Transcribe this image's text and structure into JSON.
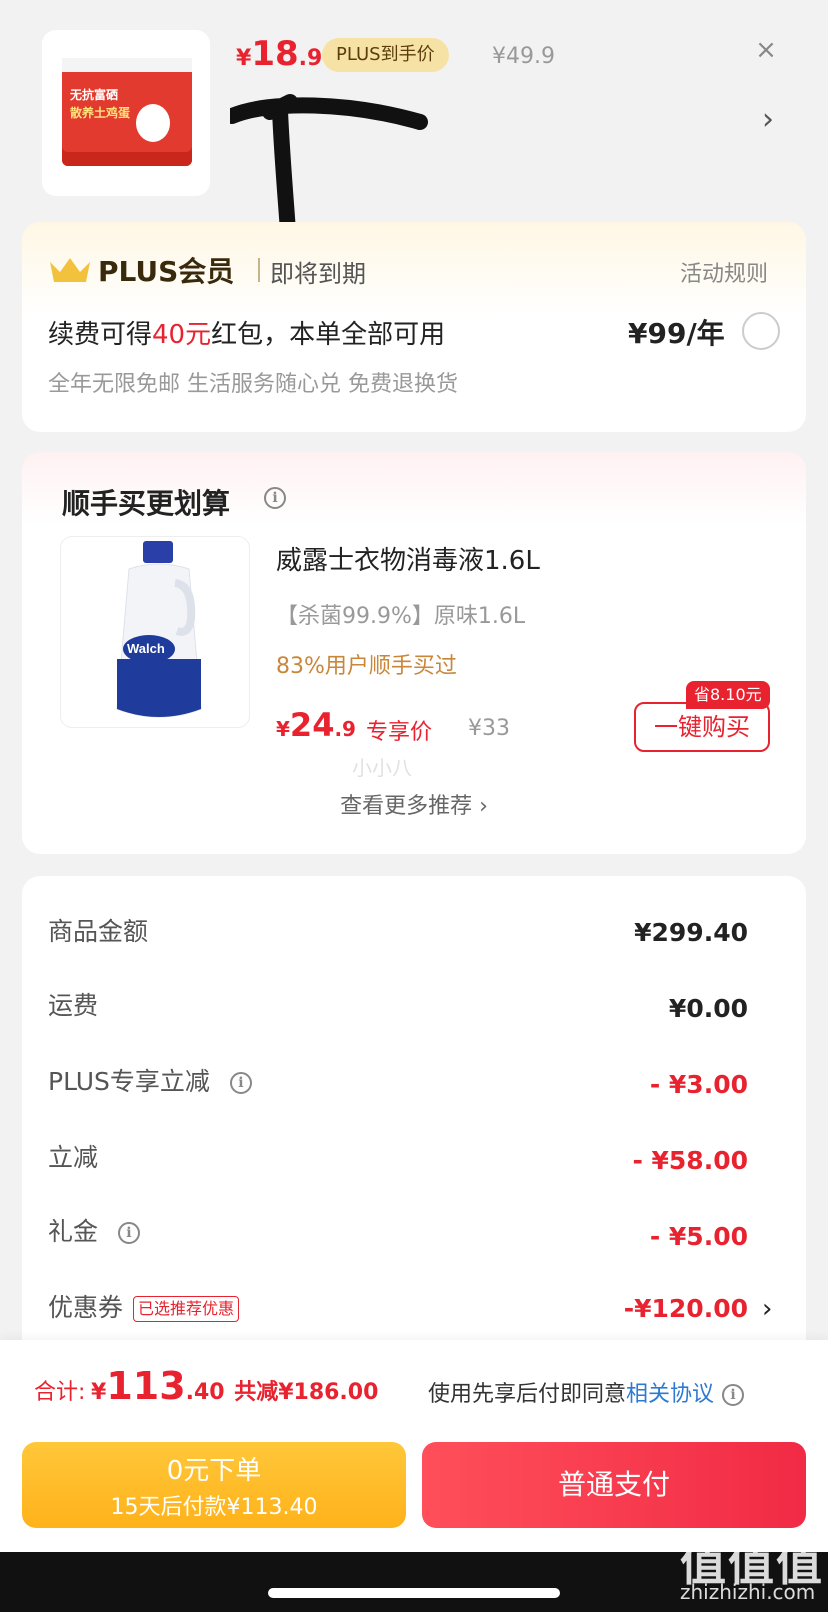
{
  "product": {
    "price_currency": "¥",
    "price_int": "18",
    "price_dec": ".9",
    "plus_tag": "PLUS到手价",
    "original_price": "¥49.9",
    "close_icon": "×",
    "spec_chevron": "›",
    "box_text_1": "无抗富硒",
    "box_text_2": "散养土鸡蛋"
  },
  "plus": {
    "title": "PLUS会员",
    "status": "即将到期",
    "rules_link": "活动规则",
    "renew_prefix": "续费可得",
    "renew_amount": "40元",
    "renew_suffix": "红包，本单全部可用",
    "renew_price": "¥99/年",
    "benefits": "全年无限免邮 生活服务随心兑 免费退换货"
  },
  "recommend": {
    "title": "顺手买更划算",
    "item_name": "威露士衣物消毒液1.6L",
    "item_spec": "【杀菌99.9%】原味1.6L",
    "item_bought": "83%用户顺手买过",
    "price_currency": "¥",
    "price_int": "24",
    "price_dec": ".9",
    "price_tag": "专享价",
    "original_price": "¥33",
    "save_tag": "省8.10元",
    "buy_button": "一键购买",
    "more": "查看更多推荐 ›",
    "brand_text": "Walch"
  },
  "amounts": {
    "rows": [
      {
        "label": "商品金额",
        "value": "¥299.40"
      },
      {
        "label": "运费",
        "value": "¥0.00"
      },
      {
        "label": "PLUS专享立减",
        "value": "- ¥3.00"
      },
      {
        "label": "立减",
        "value": "- ¥58.00"
      },
      {
        "label": "礼金",
        "value": "- ¥5.00"
      },
      {
        "label": "优惠券",
        "value": "-¥120.00",
        "tag": "已选推荐优惠"
      }
    ],
    "coupon_chevron": "›"
  },
  "footer": {
    "total_label": "合计:",
    "total_currency": "¥",
    "total_int": "113",
    "total_dec": ".40",
    "total_saved": "共减¥186.00",
    "agree_prefix": "使用先享后付即同意",
    "agree_link": "相关协议",
    "btn_zero_line1": "0元下单",
    "btn_zero_line2": "15天后付款¥113.40",
    "btn_pay": "普通支付"
  },
  "watermark": {
    "logo": "值值值",
    "site": "zhizhizhi.com",
    "mid": "小小八"
  },
  "colors": {
    "accent_red": "#e8232f",
    "plus_gold": "#f7e2a6",
    "link_blue": "#2e7ad1",
    "btn_yellow": "#ffb21a"
  }
}
